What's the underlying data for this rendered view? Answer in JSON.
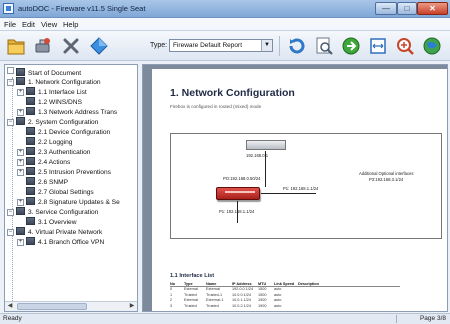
{
  "window": {
    "title": "autoDOC - Fireware v11.5 Single Seat",
    "minimize": "—",
    "maximize": "□",
    "close": "✕"
  },
  "menu": [
    "File",
    "Edit",
    "View",
    "Help"
  ],
  "toolbar": {
    "type_label": "Type:",
    "type_value": "Fireware Default Report",
    "buttons": [
      "folder-icon",
      "tools-icon",
      "wrench-cross-icon",
      "diamond-icon",
      "refresh-icon",
      "zoom-page-icon",
      "go-icon",
      "fit-width-icon",
      "zoom-in-icon",
      "globe-icon"
    ]
  },
  "tree": {
    "items": [
      {
        "label": "Start of Document",
        "pm": ""
      },
      {
        "label": "1. Network Configuration",
        "pm": "−"
      },
      {
        "label": "1.1 Interface List",
        "pm": "+"
      },
      {
        "label": "1.2 WINS/DNS",
        "pm": ""
      },
      {
        "label": "1.3 Network Address Trans",
        "pm": "+"
      },
      {
        "label": "2. System Configuration",
        "pm": "−"
      },
      {
        "label": "2.1 Device Configuration",
        "pm": ""
      },
      {
        "label": "2.2 Logging",
        "pm": ""
      },
      {
        "label": "2.3 Authentication",
        "pm": "+"
      },
      {
        "label": "2.4 Actions",
        "pm": "+"
      },
      {
        "label": "2.5 Intrusion Preventions",
        "pm": "+"
      },
      {
        "label": "2.6 SNMP",
        "pm": ""
      },
      {
        "label": "2.7 Global Settings",
        "pm": ""
      },
      {
        "label": "2.8 Signature Updates & Se",
        "pm": "+"
      },
      {
        "label": "3. Service Configuration",
        "pm": "−"
      },
      {
        "label": "3.1 Overview",
        "pm": ""
      },
      {
        "label": "4. Virtual Private Network",
        "pm": "−"
      },
      {
        "label": "4.1 Branch Office VPN",
        "pm": "+"
      }
    ]
  },
  "document": {
    "heading": "1. Network Configuration",
    "subtext": "Firebox is configured in routed (mixed) mode",
    "diagram": {
      "switch_ip": "192.168.0.1",
      "fw_top_ip": "PO:192.168.0.50/24",
      "fw_right_ip": "P1: 192.168.1.1/24",
      "fw_bottom_ip": "P1: 192.168.1.1/24",
      "note_line1": "Additional Optional interfaces",
      "note_line2": "P3:192.168.3.1/24"
    },
    "section2_heading": "1.1 Interface List",
    "table": {
      "headers": [
        "No",
        "Type",
        "Name",
        "IP Address",
        "MTU",
        "Link Speed",
        "Description"
      ],
      "rows": [
        [
          "0",
          "External",
          "External",
          "192.0.0.1/24",
          "1500",
          "auto",
          ""
        ],
        [
          "1",
          "Trusted",
          "Trusted-1",
          "10.0.0.1/24",
          "1500",
          "auto",
          ""
        ],
        [
          "2",
          "External",
          "External-1",
          "10.0.1.1/24",
          "1500",
          "auto",
          ""
        ],
        [
          "3",
          "Trusted",
          "Trusted",
          "10.0.2.1/24",
          "1500",
          "auto",
          ""
        ]
      ]
    }
  },
  "status": {
    "left": "Ready",
    "right": "Page 3/8"
  },
  "colors": {
    "titlebar": "#7fa7d6",
    "firewall": "#c42d24",
    "close_button": "#c84029"
  }
}
